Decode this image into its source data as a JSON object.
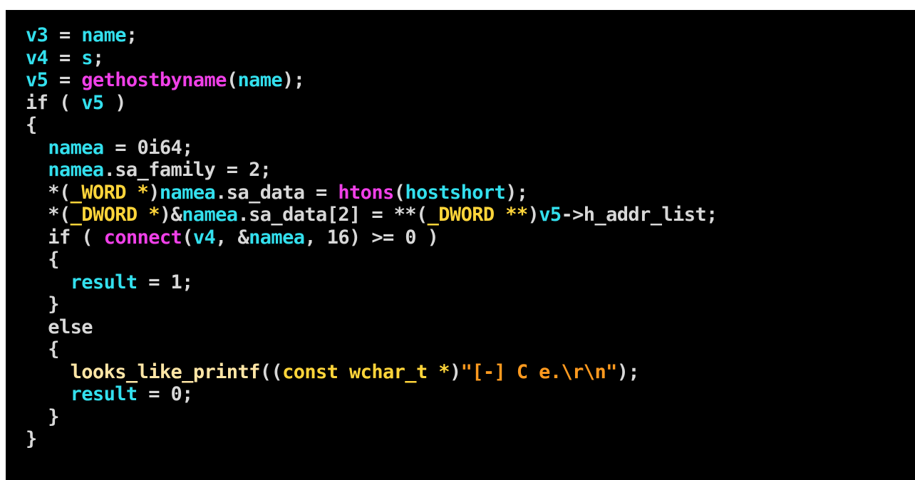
{
  "colors": {
    "background": "#000000",
    "plain": "#d8d8d8",
    "variable": "#33e0ee",
    "function": "#f040e8",
    "type": "#ffd53a",
    "string": "#ff9a1f",
    "user_function": "#ffe6a6"
  },
  "code": {
    "lines": [
      [
        [
          "var",
          "v3"
        ],
        [
          "plain",
          " = "
        ],
        [
          "var",
          "name"
        ],
        [
          "plain",
          ";"
        ]
      ],
      [
        [
          "var",
          "v4"
        ],
        [
          "plain",
          " = "
        ],
        [
          "var",
          "s"
        ],
        [
          "plain",
          ";"
        ]
      ],
      [
        [
          "var",
          "v5"
        ],
        [
          "plain",
          " = "
        ],
        [
          "func",
          "gethostbyname"
        ],
        [
          "plain",
          "("
        ],
        [
          "var",
          "name"
        ],
        [
          "plain",
          ");"
        ]
      ],
      [
        [
          "plain",
          "if ( "
        ],
        [
          "var",
          "v5"
        ],
        [
          "plain",
          " )"
        ]
      ],
      [
        [
          "plain",
          "{"
        ]
      ],
      [
        [
          "plain",
          "  "
        ],
        [
          "var",
          "namea"
        ],
        [
          "plain",
          " = 0i64;"
        ]
      ],
      [
        [
          "plain",
          "  "
        ],
        [
          "var",
          "namea"
        ],
        [
          "plain",
          ".sa_family = 2;"
        ]
      ],
      [
        [
          "plain",
          "  *("
        ],
        [
          "type",
          "_WORD *"
        ],
        [
          "plain",
          ")"
        ],
        [
          "var",
          "namea"
        ],
        [
          "plain",
          ".sa_data = "
        ],
        [
          "func",
          "htons"
        ],
        [
          "plain",
          "("
        ],
        [
          "var",
          "hostshort"
        ],
        [
          "plain",
          ");"
        ]
      ],
      [
        [
          "plain",
          "  *("
        ],
        [
          "type",
          "_DWORD *"
        ],
        [
          "plain",
          ")&"
        ],
        [
          "var",
          "namea"
        ],
        [
          "plain",
          ".sa_data[2] = **("
        ],
        [
          "type",
          "_DWORD **"
        ],
        [
          "plain",
          ")"
        ],
        [
          "var",
          "v5"
        ],
        [
          "plain",
          "->h_addr_list;"
        ]
      ],
      [
        [
          "plain",
          "  if ( "
        ],
        [
          "func",
          "connect"
        ],
        [
          "plain",
          "("
        ],
        [
          "var",
          "v4"
        ],
        [
          "plain",
          ", &"
        ],
        [
          "var",
          "namea"
        ],
        [
          "plain",
          ", 16) >= 0 )"
        ]
      ],
      [
        [
          "plain",
          "  {"
        ]
      ],
      [
        [
          "plain",
          "    "
        ],
        [
          "var",
          "result"
        ],
        [
          "plain",
          " = 1;"
        ]
      ],
      [
        [
          "plain",
          "  }"
        ]
      ],
      [
        [
          "plain",
          "  else"
        ]
      ],
      [
        [
          "plain",
          "  {"
        ]
      ],
      [
        [
          "plain",
          "    "
        ],
        [
          "ufunc",
          "looks_like_printf"
        ],
        [
          "plain",
          "(("
        ],
        [
          "type",
          "const wchar_t *"
        ],
        [
          "plain",
          ")"
        ],
        [
          "str",
          "\"[-] C e.\\r\\n\""
        ],
        [
          "plain",
          ");"
        ]
      ],
      [
        [
          "plain",
          "    "
        ],
        [
          "var",
          "result"
        ],
        [
          "plain",
          " = 0;"
        ]
      ],
      [
        [
          "plain",
          "  }"
        ]
      ],
      [
        [
          "plain",
          "}"
        ]
      ]
    ]
  }
}
